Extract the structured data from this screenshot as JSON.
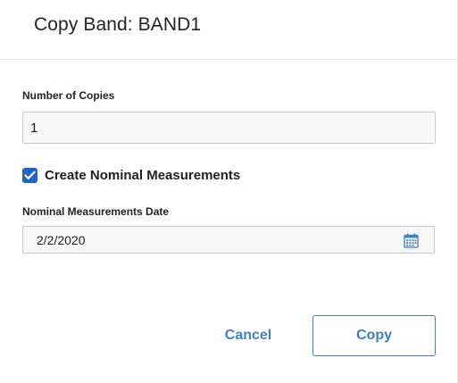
{
  "dialog": {
    "title": "Copy Band: BAND1"
  },
  "form": {
    "copies_label": "Number of Copies",
    "copies_value": "1",
    "nominal_checkbox_label": "Create Nominal Measurements",
    "nominal_checked": true,
    "date_label": "Nominal Measurements Date",
    "date_value": "2/2/2020",
    "date_icon": "calendar-icon"
  },
  "actions": {
    "cancel_label": "Cancel",
    "copy_label": "Copy"
  },
  "colors": {
    "accent": "#3f7fc9",
    "checkbox": "#1f63c9",
    "input_bg": "#f7f7f7",
    "border": "#c8c8c8"
  }
}
